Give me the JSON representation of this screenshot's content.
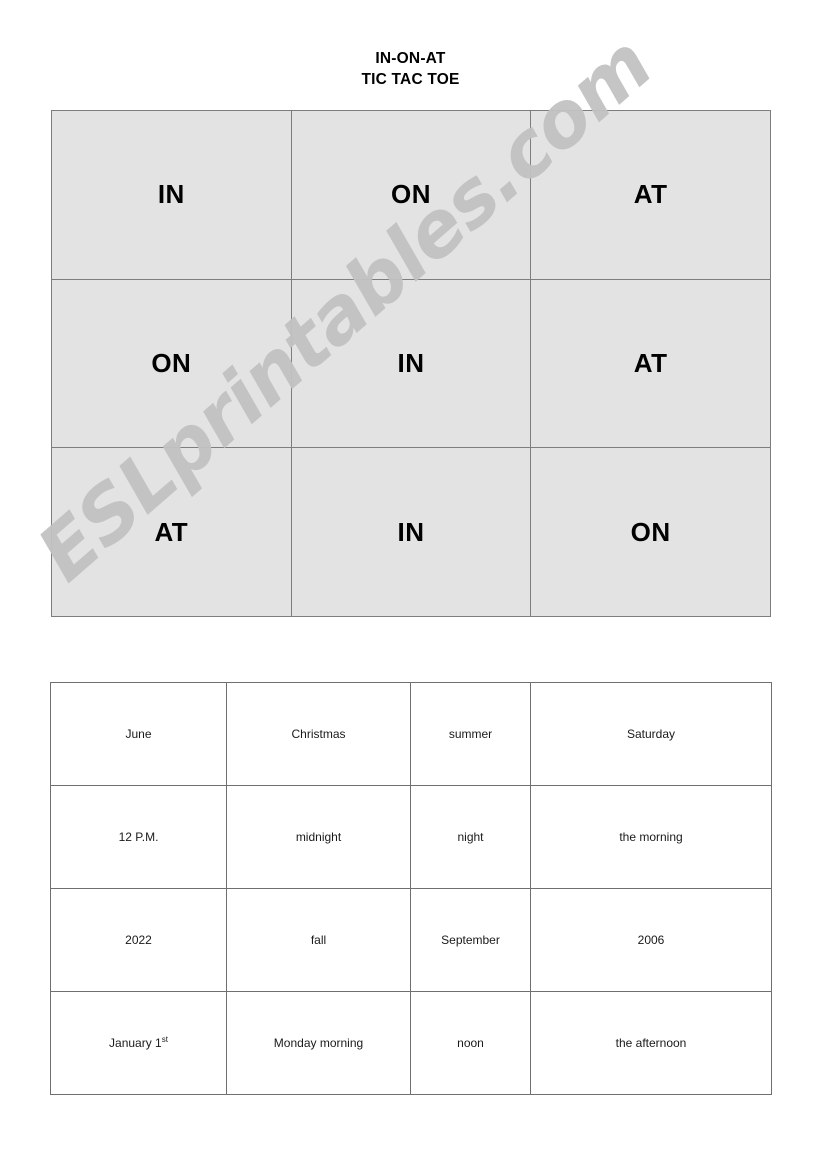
{
  "page": {
    "title_lines": [
      "IN-ON-AT",
      "TIC TAC TOE"
    ],
    "watermark": "ESLprintables.com"
  },
  "tic_tac_toe": {
    "rows": [
      [
        "IN",
        "ON",
        "AT"
      ],
      [
        "ON",
        "IN",
        "AT"
      ],
      [
        "AT",
        "IN",
        "ON"
      ]
    ],
    "cells": [
      "IN",
      "ON",
      "AT",
      "ON",
      "IN",
      "AT",
      "AT",
      "IN",
      "ON"
    ]
  },
  "word_table": {
    "rows": [
      [
        "June",
        "Christmas",
        "summer",
        "Saturday"
      ],
      [
        "12 P.M.",
        "midnight",
        "night",
        "the morning"
      ],
      [
        "2022",
        "fall",
        "September",
        "2006"
      ],
      [
        "January 1",
        "Monday morning",
        "noon",
        "the afternoon"
      ]
    ],
    "january_suffix": "st",
    "cells": [
      "June",
      "Christmas",
      "summer",
      "Saturday",
      "12 P.M.",
      "midnight",
      "night",
      "the morning",
      "2022",
      "fall",
      "September",
      "2006",
      "January 1",
      "Monday morning",
      "noon",
      "the afternoon"
    ]
  },
  "colors": {
    "cell_fill": "#e3e3e3",
    "grid_border": "#7d7d7d",
    "table_border": "#6f6f6f",
    "watermark": "#c2c2c2",
    "text": "#111111"
  }
}
